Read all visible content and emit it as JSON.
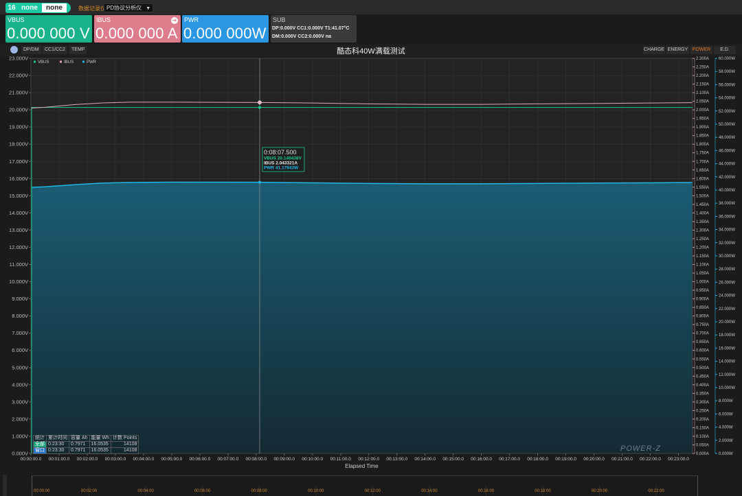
{
  "device": {
    "number": "16",
    "mode_a": "none",
    "mode_b": "none"
  },
  "toolbar": {
    "record_link": "数据记录仪",
    "analyzer_select": "PD协议分析仪"
  },
  "meters": {
    "vbus": {
      "label": "VBUS",
      "value": "0.000 000 V"
    },
    "ibus": {
      "label": "IBUS",
      "value": "0.000 000 A"
    },
    "pwr": {
      "label": "PWR",
      "value": "0.000 000W"
    },
    "sub": {
      "label": "SUB",
      "row1": "DP:0.000V  CC1:0.000V  T1:41.07°C",
      "row2": "DM:0.000V  CC2:0.000V  na"
    }
  },
  "chart_header": {
    "left_tabs": [
      "DP/DM",
      "CC1/CC2",
      "TEMP"
    ],
    "title": "酷态科40W满载测试",
    "right_tabs": [
      "CHARGE",
      "ENERGY",
      "POWER",
      "E.D."
    ],
    "active_tab": "POWER"
  },
  "colors": {
    "vbus": "#19c98e",
    "ibus": "#e3aab6",
    "pwr": "#1fb6e6",
    "accent": "#e8742c",
    "tooltip_border": "#19c98e"
  },
  "legend": [
    "VBUS",
    "IBUS",
    "PWR"
  ],
  "tooltip": {
    "time": "0:08:07.500",
    "vbus": "VBUS   20.140438V",
    "ibus": "IBUS   2.043321A",
    "pwr": "PWR    41.17943W"
  },
  "stats": {
    "headers": [
      "统计",
      "累计时间",
      "容量 Ah",
      "能量 Wh",
      "计数 Points"
    ],
    "rows": [
      [
        "全部",
        "0:23:30",
        "0.7971",
        "16.0535",
        "14108"
      ],
      [
        "窗口",
        "0:23:30",
        "0.7971",
        "16.0535",
        "14108"
      ]
    ]
  },
  "watermark": "POWER-Z",
  "chart_data": {
    "type": "line",
    "xlabel": "Elapsed Time",
    "x_tick_labels": [
      "00:00:00.0",
      "00:01:00.0",
      "00:02:00.0",
      "00:03:00.0",
      "00:04:00.0",
      "00:05:00.0",
      "00:06:00.0",
      "00:07:00.0",
      "00:08:00.0",
      "00:09:00.0",
      "00:10:00.0",
      "00:11:00.0",
      "00:12:00.0",
      "00:13:00.0",
      "00:14:00.0",
      "00:15:00.0",
      "00:16:00.0",
      "00:17:00.0",
      "00:18:00.0",
      "00:19:00.0",
      "00:20:00.0",
      "00:21:00.0",
      "00:22:00.0",
      "00:23:00.0"
    ],
    "xlim": [
      0,
      23.5
    ],
    "y_voltage": {
      "lim": [
        0,
        23
      ],
      "ticks": [
        "0.000V",
        "1.000V",
        "2.000V",
        "3.000V",
        "4.000V",
        "5.000V",
        "6.000V",
        "7.000V",
        "8.000V",
        "9.000V",
        "10.000V",
        "11.000V",
        "12.000V",
        "13.000V",
        "14.000V",
        "15.000V",
        "16.000V",
        "17.000V",
        "18.000V",
        "19.000V",
        "20.000V",
        "21.000V",
        "22.000V",
        "23.000V"
      ]
    },
    "y_current": {
      "lim": [
        0,
        2.3
      ],
      "ticks": [
        "0.000A",
        "0.050A",
        "0.100A",
        "0.150A",
        "0.200A",
        "0.250A",
        "0.300A",
        "0.350A",
        "0.400A",
        "0.450A",
        "0.500A",
        "0.550A",
        "0.600A",
        "0.650A",
        "0.700A",
        "0.750A",
        "0.800A",
        "0.850A",
        "0.900A",
        "0.950A",
        "1.000A",
        "1.050A",
        "1.100A",
        "1.150A",
        "1.200A",
        "1.250A",
        "1.300A",
        "1.350A",
        "1.400A",
        "1.450A",
        "1.500A",
        "1.550A",
        "1.600A",
        "1.650A",
        "1.700A",
        "1.750A",
        "1.800A",
        "1.850A",
        "1.900A",
        "1.950A",
        "2.000A",
        "2.050A",
        "2.100A",
        "2.150A",
        "2.200A",
        "2.250A",
        "2.300A"
      ]
    },
    "y_power": {
      "lim": [
        0,
        60
      ],
      "ticks": [
        "0.000W",
        "2.000W",
        "4.000W",
        "6.000W",
        "8.000W",
        "10.000W",
        "12.000W",
        "14.000W",
        "16.000W",
        "18.000W",
        "20.000W",
        "22.000W",
        "24.000W",
        "26.000W",
        "28.000W",
        "30.000W",
        "32.000W",
        "34.000W",
        "36.000W",
        "38.000W",
        "40.000W",
        "42.000W",
        "44.000W",
        "46.000W",
        "48.000W",
        "50.000W",
        "52.000W",
        "54.000W",
        "56.000W",
        "58.000W",
        "60.000W"
      ]
    },
    "overview_ticks": [
      "00:00:00",
      "00:02:00",
      "00:04:00",
      "00:06:00",
      "00:08:00",
      "00:10:00",
      "00:12:00",
      "00:14:00",
      "00:16:00",
      "00:18:00",
      "00:20:00",
      "00:22:00"
    ],
    "cursor_x": 8.125,
    "series": [
      {
        "name": "VBUS",
        "x": [
          0,
          23.5
        ],
        "values": [
          20.14,
          20.14
        ]
      },
      {
        "name": "IBUS",
        "x": [
          0,
          0.5,
          1.5,
          2.5,
          3.5,
          5,
          8,
          10,
          12,
          14,
          16,
          18,
          20,
          22,
          23.5
        ],
        "values": [
          2.01,
          2.015,
          2.03,
          2.04,
          2.045,
          2.045,
          2.043,
          2.04,
          2.035,
          2.032,
          2.032,
          2.035,
          2.037,
          2.04,
          2.042
        ]
      },
      {
        "name": "PWR",
        "x": [
          0,
          0.5,
          1.5,
          2.5,
          3.5,
          5,
          8,
          10,
          12,
          14,
          16,
          18,
          20,
          22,
          23.5
        ],
        "values": [
          40.4,
          40.5,
          40.8,
          41.05,
          41.15,
          41.2,
          41.18,
          41.1,
          41.0,
          40.95,
          40.95,
          41.0,
          41.05,
          41.1,
          41.15
        ]
      }
    ]
  }
}
